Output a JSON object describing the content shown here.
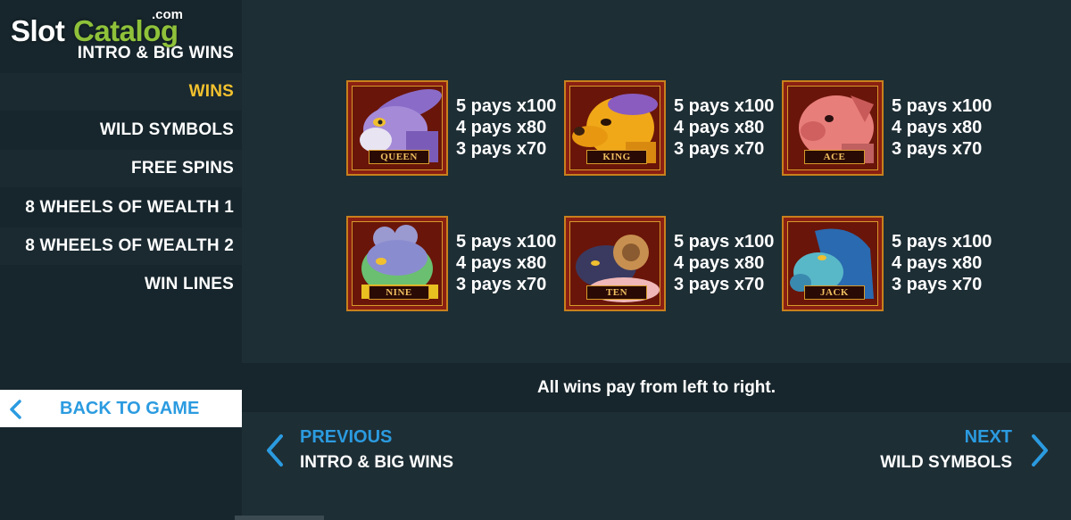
{
  "logo": {
    "slot": "Slot",
    "catalog": "Catalog",
    "com": ".com"
  },
  "sidebar": {
    "items": [
      {
        "label": "INTRO & BIG WINS"
      },
      {
        "label": "WINS"
      },
      {
        "label": "WILD SYMBOLS"
      },
      {
        "label": "FREE SPINS"
      },
      {
        "label": "8 WHEELS OF WEALTH 1"
      },
      {
        "label": "8 WHEELS OF WEALTH 2"
      },
      {
        "label": "WIN LINES"
      }
    ],
    "active_index": 1,
    "back_label": "BACK TO GAME"
  },
  "symbols": [
    {
      "name": "QUEEN",
      "animal": "rabbit-icon",
      "pays": [
        "5 pays x100",
        "4 pays x80",
        "3 pays x70"
      ]
    },
    {
      "name": "KING",
      "animal": "dog-icon",
      "pays": [
        "5 pays x100",
        "4 pays x80",
        "3 pays x70"
      ]
    },
    {
      "name": "ACE",
      "animal": "pig-icon",
      "pays": [
        "5 pays x100",
        "4 pays x80",
        "3 pays x70"
      ]
    },
    {
      "name": "NINE",
      "animal": "rat-icon",
      "pays": [
        "5 pays x100",
        "4 pays x80",
        "3 pays x70"
      ]
    },
    {
      "name": "TEN",
      "animal": "ram-icon",
      "pays": [
        "5 pays x100",
        "4 pays x80",
        "3 pays x70"
      ]
    },
    {
      "name": "JACK",
      "animal": "horse-icon",
      "pays": [
        "5 pays x100",
        "4 pays x80",
        "3 pays x70"
      ]
    }
  ],
  "note": "All wins pay from left to right.",
  "pager": {
    "previous": {
      "title": "PREVIOUS",
      "sub": "INTRO & BIG WINS"
    },
    "next": {
      "title": "NEXT",
      "sub": "WILD SYMBOLS"
    }
  },
  "colors": {
    "accent_blue": "#2b9be0",
    "active_yellow": "#f2c12e",
    "frame_red": "#8a1f12",
    "frame_gold": "#c8801c",
    "logo_green": "#8fc23a"
  }
}
